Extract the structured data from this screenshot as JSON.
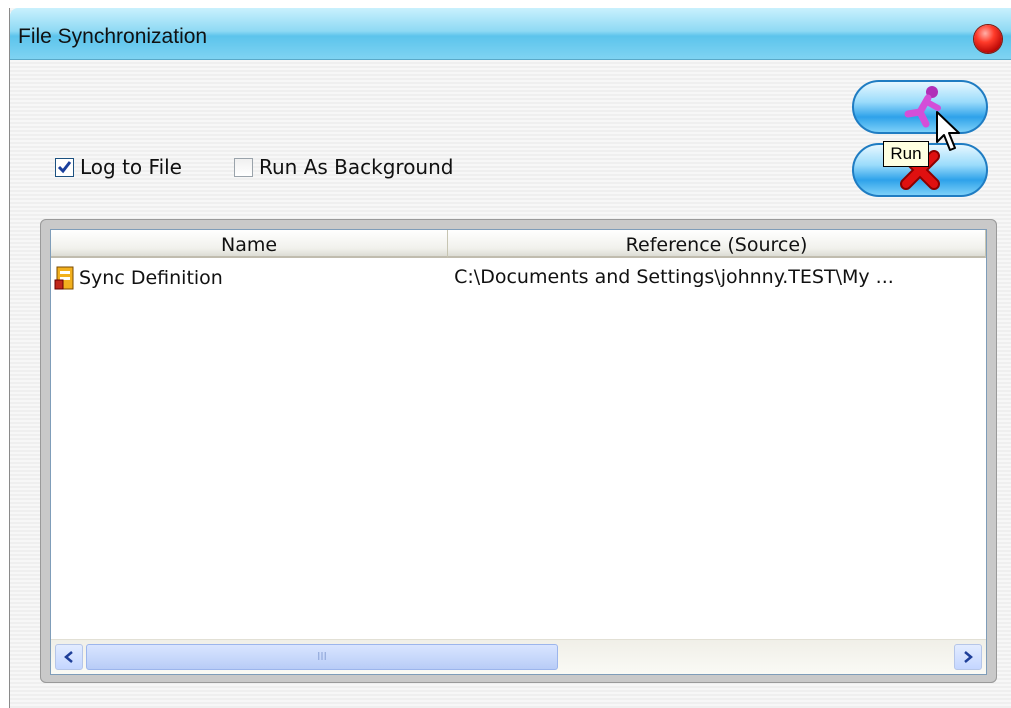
{
  "window": {
    "title": "File Synchronization"
  },
  "options": {
    "log_to_file": {
      "label": "Log to File",
      "checked": true
    },
    "run_as_background": {
      "label": "Run As Background",
      "checked": false
    }
  },
  "tooltip": "Run",
  "icons": {
    "run": "running-figure-icon",
    "stop": "red-x-icon",
    "close": "red-orb-close-icon",
    "sync_item": "sync-definition-icon",
    "cursor": "mouse-pointer-icon"
  },
  "table": {
    "columns": [
      "Name",
      "Reference (Source)"
    ],
    "rows": [
      {
        "name": "Sync Definition",
        "reference": "C:\\Documents and Settings\\johnny.TEST\\My ..."
      }
    ]
  },
  "scrollbar": {
    "thumb_grip": "III"
  },
  "colors": {
    "title_bar": "#8fdaf4",
    "accent_blue": "#1f7cc2",
    "stop_red": "#e01010"
  }
}
